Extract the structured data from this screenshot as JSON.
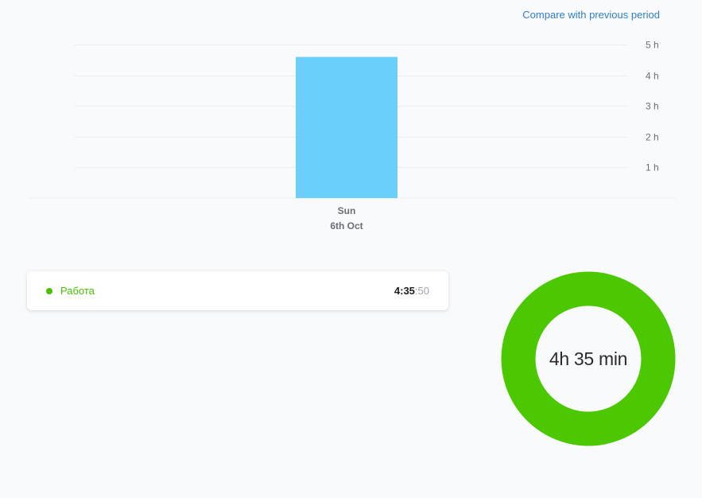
{
  "header": {
    "compare_link": "Compare with previous period"
  },
  "chart_data": {
    "type": "bar",
    "categories": [
      "Sun"
    ],
    "category_sublabels": [
      "6th Oct"
    ],
    "values": [
      4.597
    ],
    "y_ticks": [
      "1 h",
      "2 h",
      "3 h",
      "4 h",
      "5 h"
    ],
    "ylim": [
      0,
      5
    ],
    "grid": true,
    "bar_color": "#6ccefb"
  },
  "entries": [
    {
      "label": "Работа",
      "time_hm": "4:35",
      "time_sec": ":50",
      "color": "#46c000"
    }
  ],
  "donut": {
    "label": "4h 35 min",
    "color": "#4bc800"
  }
}
